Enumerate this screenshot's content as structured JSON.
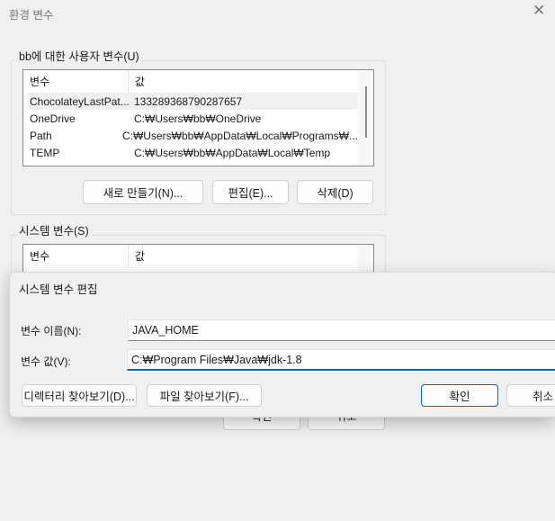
{
  "window": {
    "title": "환경 변수"
  },
  "user_vars": {
    "legend": "bb에 대한 사용자 변수(U)",
    "col_var": "변수",
    "col_val": "값",
    "rows": [
      {
        "name": "ChocolateyLastPat...",
        "value": "133289368790287657"
      },
      {
        "name": "OneDrive",
        "value": "C:₩Users₩bb₩OneDrive"
      },
      {
        "name": "Path",
        "value": "C:₩Users₩bb₩AppData₩Local₩Programs₩..."
      },
      {
        "name": "TEMP",
        "value": "C:₩Users₩bb₩AppData₩Local₩Temp"
      }
    ],
    "new_btn": "새로 만들기(N)...",
    "edit_btn": "편집(E)...",
    "delete_btn": "삭제(D)"
  },
  "system_vars": {
    "legend": "시스템 변수(S)",
    "col_var": "변수",
    "col_val": "값"
  },
  "main_buttons": {
    "ok": "확인",
    "cancel": "취소"
  },
  "edit_dialog": {
    "title": "시스템 변수 편집",
    "name_label": "변수 이름(N):",
    "name_value": "JAVA_HOME",
    "value_label": "변수 값(V):",
    "value_value": "C:₩Program Files₩Java₩jdk-1.8",
    "browse_dir": "디렉터리 찾아보기(D)...",
    "browse_file": "파일 찾아보기(F)...",
    "ok": "확인",
    "cancel": "취소"
  }
}
